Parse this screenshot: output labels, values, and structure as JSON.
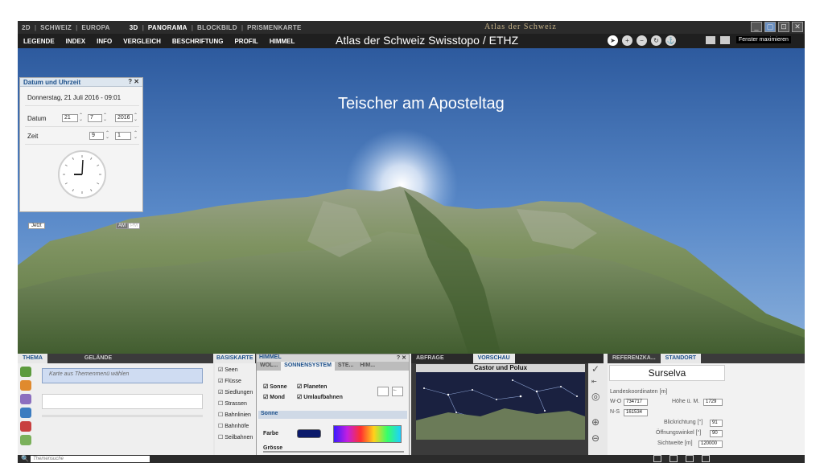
{
  "modes": [
    "2D",
    "SCHWEIZ",
    "EUROPA",
    "3D",
    "PANORAMA",
    "BLOCKBILD",
    "PRISMENKARTE"
  ],
  "app_title": "Atlas der Schweiz",
  "menu": [
    "LEGENDE",
    "INDEX",
    "INFO",
    "VERGLEICH",
    "BESCHRIFTUNG",
    "PROFIL",
    "HIMMEL"
  ],
  "overlay_title": "Atlas der Schweiz Swisstopo / ETHZ",
  "maximize_label": "Fenster maximieren",
  "scene_caption": "Teischer am Aposteltag",
  "datewin": {
    "title": "Datum und Uhrzeit",
    "title_ctl": "? ✕",
    "full_date": "Donnerstag, 21 Juli 2016 - 09:01",
    "datum_label": "Datum",
    "day": "21",
    "month": "7",
    "year": "2016",
    "zeit_label": "Zeit",
    "hour": "9",
    "minute": "1",
    "now_label": "Jetzt",
    "am": "AM",
    "pm": "PM"
  },
  "thema": {
    "tabs": [
      "THEMA",
      "GELÄNDE"
    ],
    "select_placeholder": "Karte aus Themenmenü wählen"
  },
  "basis": {
    "tab": "BASISKARTE",
    "items": [
      "Seen",
      "Flüsse",
      "Siedlungen",
      "Strassen",
      "Bahnlinien",
      "Bahnhöfe",
      "Seilbahnen"
    ]
  },
  "himmel": {
    "title": "HIMMEL",
    "title_ctl": "? ✕",
    "tabs": [
      "WOL...",
      "SONNENSYSTEM",
      "STE...",
      "HIM..."
    ],
    "checks": [
      "Sonne",
      "Planeten",
      "Mond",
      "Umlaufbahnen"
    ],
    "back_label": "←",
    "section": "Sonne",
    "farbe_label": "Farbe",
    "groesse_label": "Grösse"
  },
  "preview": {
    "tabs": [
      "ABFRAGE",
      "VORSCHAU"
    ],
    "title": "Castor und Polux"
  },
  "standort": {
    "tabs": [
      "REFERENZKA...",
      "STANDORT"
    ],
    "place": "Surselva",
    "coords_label": "Landeskoordinaten [m]",
    "wo_label": "W-O",
    "wo_value": "734717",
    "ns_label": "N-S",
    "ns_value": "161534",
    "hoehe_label": "Höhe ü. M.",
    "hoehe_value": "1729",
    "blick_label": "Blickrichtung [°]",
    "blick_value": "91",
    "oeffnung_label": "Öffnungswinkel [°]",
    "oeffnung_value": "90",
    "sicht_label": "Sichtweite [m]",
    "sicht_value": "120000"
  },
  "search_placeholder": "Themensuche",
  "icons": {
    "search": "search-icon",
    "zoom_in": "zoom-in-icon",
    "zoom_out": "zoom-out-icon"
  }
}
